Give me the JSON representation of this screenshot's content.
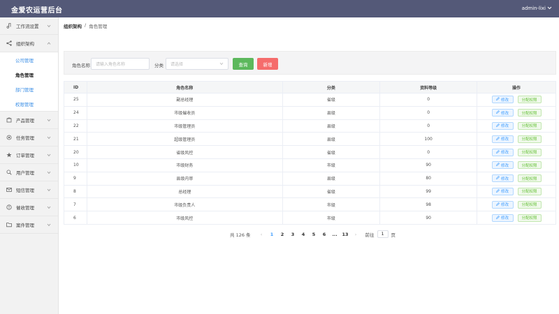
{
  "header": {
    "app_title": "金爱农运营后台",
    "user_name": "admin-lixi"
  },
  "sidebar": {
    "items": [
      {
        "label": "工作流设置",
        "icon": "music-note-icon"
      },
      {
        "label": "组织架构",
        "icon": "share-icon",
        "expanded": true,
        "children": [
          {
            "label": "公司管理",
            "active": false
          },
          {
            "label": "角色管理",
            "active": true
          },
          {
            "label": "部门管理",
            "active": false
          },
          {
            "label": "权限管理",
            "active": false
          }
        ]
      },
      {
        "label": "产品管理",
        "icon": "box-icon"
      },
      {
        "label": "任务管理",
        "icon": "target-icon"
      },
      {
        "label": "订单管理",
        "icon": "star-icon"
      },
      {
        "label": "用户管理",
        "icon": "search-icon"
      },
      {
        "label": "短信管理",
        "icon": "mail-icon"
      },
      {
        "label": "催收管理",
        "icon": "warning-icon"
      },
      {
        "label": "案件管理",
        "icon": "folder-icon"
      }
    ]
  },
  "breadcrumb": {
    "root": "组织架构",
    "separator": "/",
    "current": "角色管理"
  },
  "search": {
    "role_name_label": "角色名称",
    "role_name_placeholder": "请输入角色名称",
    "category_label": "分类",
    "category_placeholder": "请选择",
    "query_button": "查询",
    "add_button": "新增",
    "query_color": "#5cb85c",
    "add_color": "#f56c6c"
  },
  "table": {
    "headers": {
      "id": "ID",
      "name": "角色名称",
      "category": "分类",
      "level": "资料等级",
      "actions": "操作"
    },
    "edit_label": "修改",
    "perm_label": "分配权限",
    "rows": [
      {
        "id": "25",
        "name": "副总经理",
        "category": "省级",
        "level": "0"
      },
      {
        "id": "24",
        "name": "市级催收员",
        "category": "县级",
        "level": "0"
      },
      {
        "id": "22",
        "name": "市级管理员",
        "category": "县级",
        "level": "0"
      },
      {
        "id": "21",
        "name": "超级管理员",
        "category": "县级",
        "level": "100"
      },
      {
        "id": "20",
        "name": "省级风控",
        "category": "省级",
        "level": "0"
      },
      {
        "id": "10",
        "name": "市级财务",
        "category": "市级",
        "level": "90"
      },
      {
        "id": "9",
        "name": "县级内审",
        "category": "县级",
        "level": "80"
      },
      {
        "id": "8",
        "name": "总经理",
        "category": "省级",
        "level": "99"
      },
      {
        "id": "7",
        "name": "市级负责人",
        "category": "市级",
        "level": "98"
      },
      {
        "id": "6",
        "name": "市级风控",
        "category": "市级",
        "level": "90"
      }
    ]
  },
  "pagination": {
    "total_text": "共 126 条",
    "pages": [
      "1",
      "2",
      "3",
      "4",
      "5",
      "6",
      "...",
      "13"
    ],
    "current": "1",
    "goto_label": "前往",
    "goto_value": "1",
    "page_unit": "页"
  }
}
